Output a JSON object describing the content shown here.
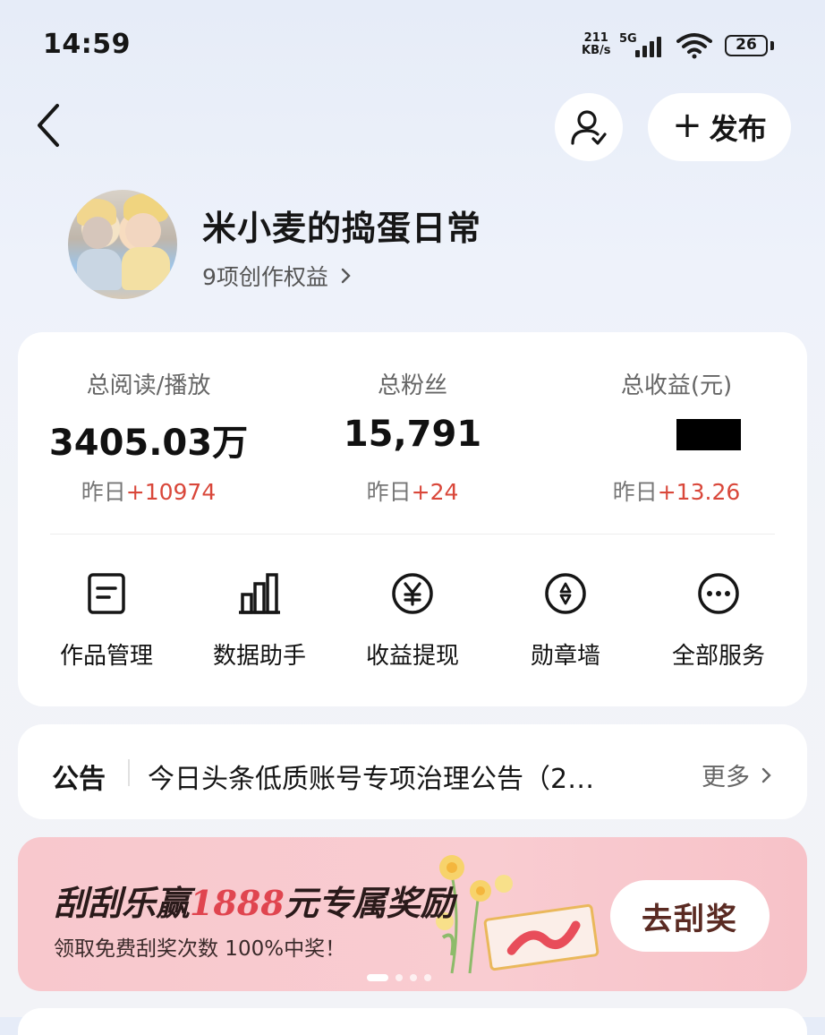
{
  "status_bar": {
    "time": "14:59",
    "net_speed_top": "211",
    "net_speed_unit": "KB/s",
    "network": "5G",
    "battery": "26"
  },
  "nav": {
    "back_icon": "chevron-left-icon",
    "user_icon": "user-check-icon",
    "publish_label": "发布",
    "publish_icon": "plus-icon"
  },
  "profile": {
    "name": "米小麦的捣蛋日常",
    "benefits": "9项创作权益"
  },
  "stats": [
    {
      "label": "总阅读/播放",
      "value": "3405.03万",
      "delta_prefix": "昨日",
      "delta": "+10974"
    },
    {
      "label": "总粉丝",
      "value": "15,791",
      "delta_prefix": "昨日",
      "delta": "+24"
    },
    {
      "label": "总收益(元)",
      "value": "",
      "delta_prefix": "昨日",
      "delta": "+13.26"
    }
  ],
  "tools": [
    {
      "label": "作品管理",
      "icon": "document-icon"
    },
    {
      "label": "数据助手",
      "icon": "bar-chart-icon"
    },
    {
      "label": "收益提现",
      "icon": "yen-icon"
    },
    {
      "label": "勋章墙",
      "icon": "badge-icon"
    },
    {
      "label": "全部服务",
      "icon": "more-icon"
    }
  ],
  "notice": {
    "title": "公告",
    "text": "今日头条低质账号专项治理公告（2…",
    "more": "更多"
  },
  "banner": {
    "title_prefix": "刮刮乐赢",
    "title_highlight": "1888",
    "title_suffix": "元专属奖励",
    "subtitle": "领取免费刮奖次数 100%中奖！",
    "button": "去刮奖",
    "colors": {
      "background": "#f8c8cd",
      "highlight": "#e0454f"
    }
  },
  "colors": {
    "accent_red": "#d9473a"
  }
}
